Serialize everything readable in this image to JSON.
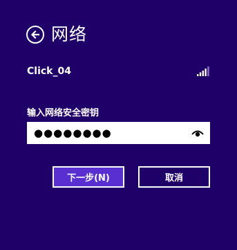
{
  "header": {
    "back_icon": "back-arrow-circle-icon",
    "title": "网络"
  },
  "network": {
    "name": "Click_04",
    "signal_icon": "wifi-signal-strength-icon"
  },
  "security_key": {
    "label": "输入网络安全密钥",
    "masked_value": "●●●●●●●●",
    "reveal_icon": "reveal-password-eye-icon"
  },
  "buttons": {
    "next_label": "下一步(N)",
    "cancel_label": "取消"
  },
  "colors": {
    "background": "#1f0068",
    "primary_button": "#5a2fd2",
    "text": "#ffffff"
  }
}
